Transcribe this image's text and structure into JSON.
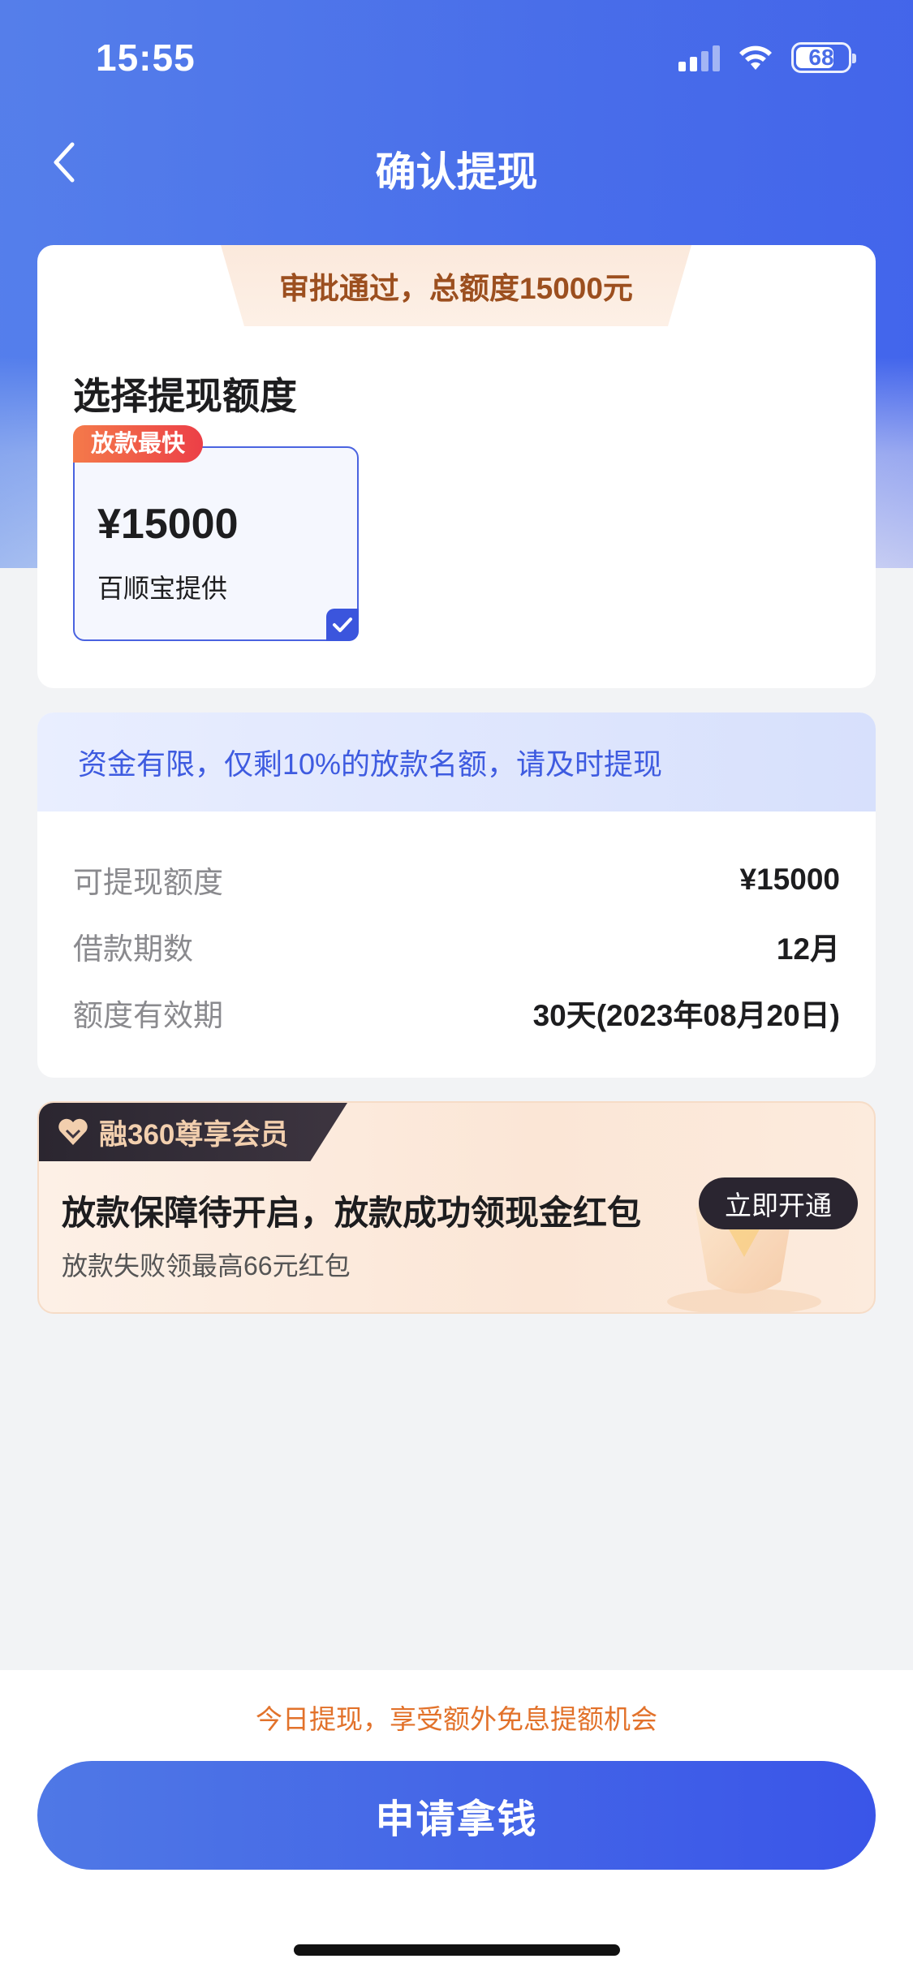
{
  "status_bar": {
    "time": "15:55",
    "battery": "68"
  },
  "nav": {
    "title": "确认提现",
    "back_icon": "chevron-left-icon"
  },
  "approval": {
    "banner": "审批通过，总额度15000元"
  },
  "amount_section": {
    "title": "选择提现额度",
    "option": {
      "badge": "放款最快",
      "amount": "¥15000",
      "provider": "百顺宝提供",
      "selected": true
    }
  },
  "info_section": {
    "notice": "资金有限，仅剩10%的放款名额，请及时提现",
    "rows": [
      {
        "label": "可提现额度",
        "value": "¥15000"
      },
      {
        "label": "借款期数",
        "value": "12月"
      },
      {
        "label": "额度有效期",
        "value": "30天(2023年08月20日)"
      }
    ]
  },
  "member": {
    "tag": "融360尊享会员",
    "headline": "放款保障待开启，放款成功领现金红包",
    "sub": "放款失败领最高66元红包",
    "button": "立即开通"
  },
  "bottom": {
    "promo": "今日提现，享受额外免息提额机会",
    "apply_button": "申请拿钱"
  },
  "colors": {
    "primary": "#3b55dd",
    "accent_orange": "#e2722b",
    "badge_red": "#ec3f47"
  }
}
